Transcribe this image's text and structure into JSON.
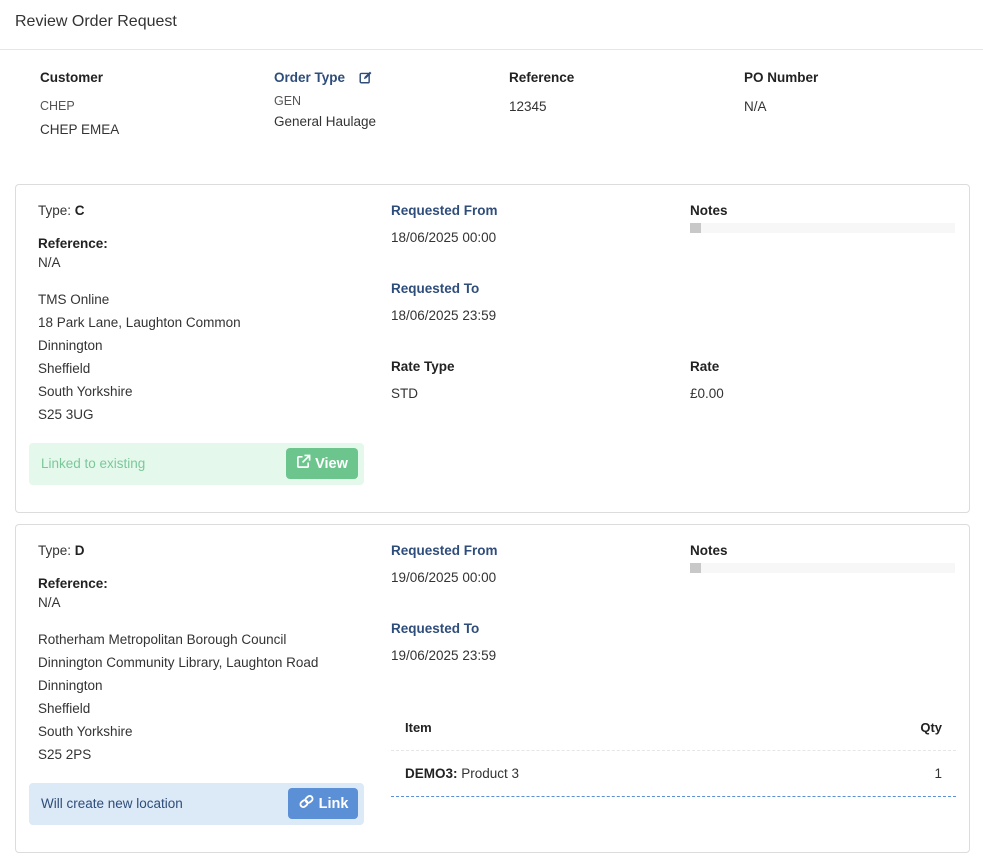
{
  "header": {
    "title": "Review Order Request"
  },
  "summary": {
    "customer": {
      "label": "Customer",
      "line1": "CHEP",
      "line2": "CHEP EMEA"
    },
    "order_type": {
      "label": "Order Type",
      "code": "GEN",
      "name": "General Haulage",
      "edit_icon": "edit-icon"
    },
    "reference": {
      "label": "Reference",
      "value": "12345"
    },
    "po_number": {
      "label": "PO Number",
      "value": "N/A"
    }
  },
  "stops": [
    {
      "type_label": "Type:",
      "type_value": "C",
      "reference_label": "Reference:",
      "reference_value": "N/A",
      "address": [
        "TMS Online",
        "18 Park Lane, Laughton Common",
        "Dinnington",
        "Sheffield",
        "South Yorkshire",
        "S25 3UG"
      ],
      "requested_from_label": "Requested From",
      "requested_from": "18/06/2025 00:00",
      "requested_to_label": "Requested To",
      "requested_to": "18/06/2025 23:59",
      "notes_label": "Notes",
      "rate_type_label": "Rate Type",
      "rate_type": "STD",
      "rate_label": "Rate",
      "rate": "£0.00",
      "status_text": "Linked to existing",
      "button_label": "View",
      "status_color": "#e4f9ec",
      "button_color": "#6cc58d"
    },
    {
      "type_label": "Type:",
      "type_value": "D",
      "reference_label": "Reference:",
      "reference_value": "N/A",
      "address": [
        "Rotherham Metropolitan Borough Council",
        "Dinnington Community Library, Laughton Road",
        "Dinnington",
        "Sheffield",
        "South Yorkshire",
        "S25 2PS"
      ],
      "requested_from_label": "Requested From",
      "requested_from": "19/06/2025 00:00",
      "requested_to_label": "Requested To",
      "requested_to": "19/06/2025 23:59",
      "notes_label": "Notes",
      "items": {
        "col_item": "Item",
        "col_qty": "Qty",
        "rows": [
          {
            "code": "DEMO3:",
            "name": "Product 3",
            "qty": "1"
          }
        ]
      },
      "status_text": "Will create new location",
      "button_label": "Link",
      "status_color": "#dce9f6",
      "button_color": "#5b8fd6"
    }
  ],
  "colors": {
    "accent": "#2e4d7b",
    "border": "#dcdcdc"
  }
}
